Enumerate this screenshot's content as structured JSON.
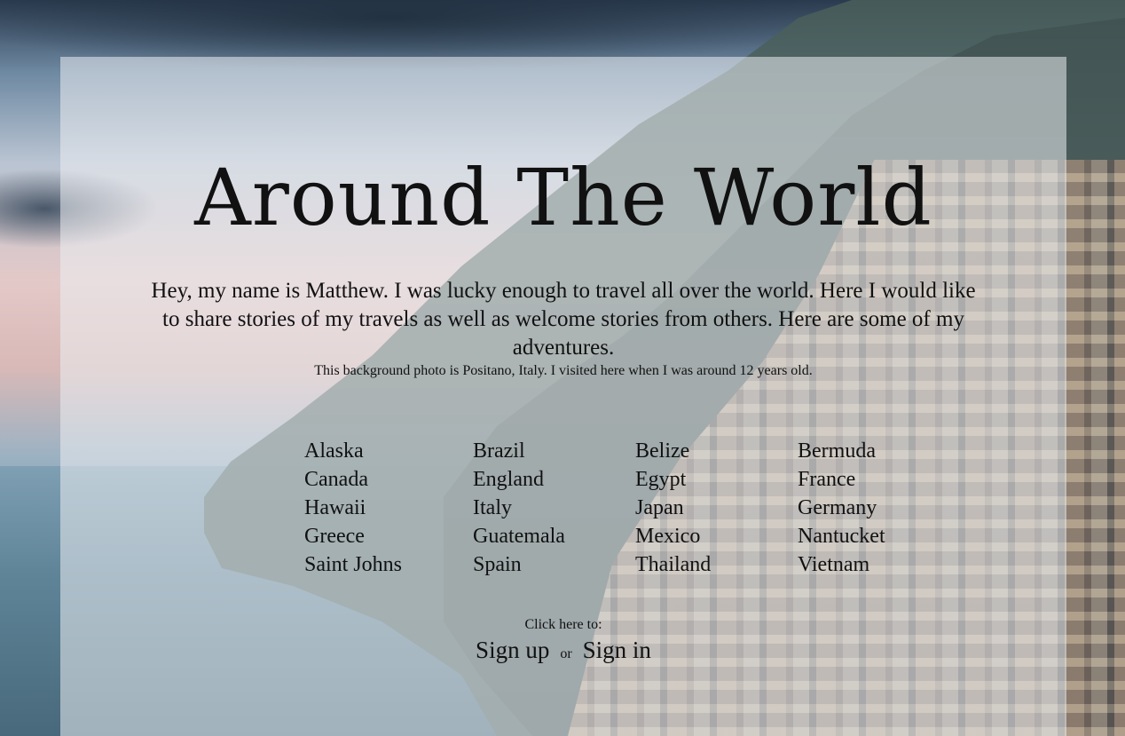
{
  "page": {
    "title": "Around The World",
    "intro": "Hey, my name is Matthew. I was lucky enough to travel all over the world. Here I would like to share stories of my travels as well as welcome stories from others. Here are some of my adventures.",
    "photo_note": "This background photo is Positano, Italy. I visited here when I was around 12 years old."
  },
  "countries": [
    "Alaska",
    "Brazil",
    "Belize",
    "Bermuda",
    "Canada",
    "England",
    "Egypt",
    "France",
    "Hawaii",
    "Italy",
    "Japan",
    "Germany",
    "Greece",
    "Guatemala",
    "Mexico",
    "Nantucket",
    "Saint Johns",
    "Spain",
    "Thailand",
    "Vietnam"
  ],
  "cta": {
    "label": "Click here to:",
    "sign_up": "Sign up",
    "or": "or",
    "sign_in": "Sign in"
  },
  "colors": {
    "panel": "#eceef2",
    "text": "#111111"
  }
}
